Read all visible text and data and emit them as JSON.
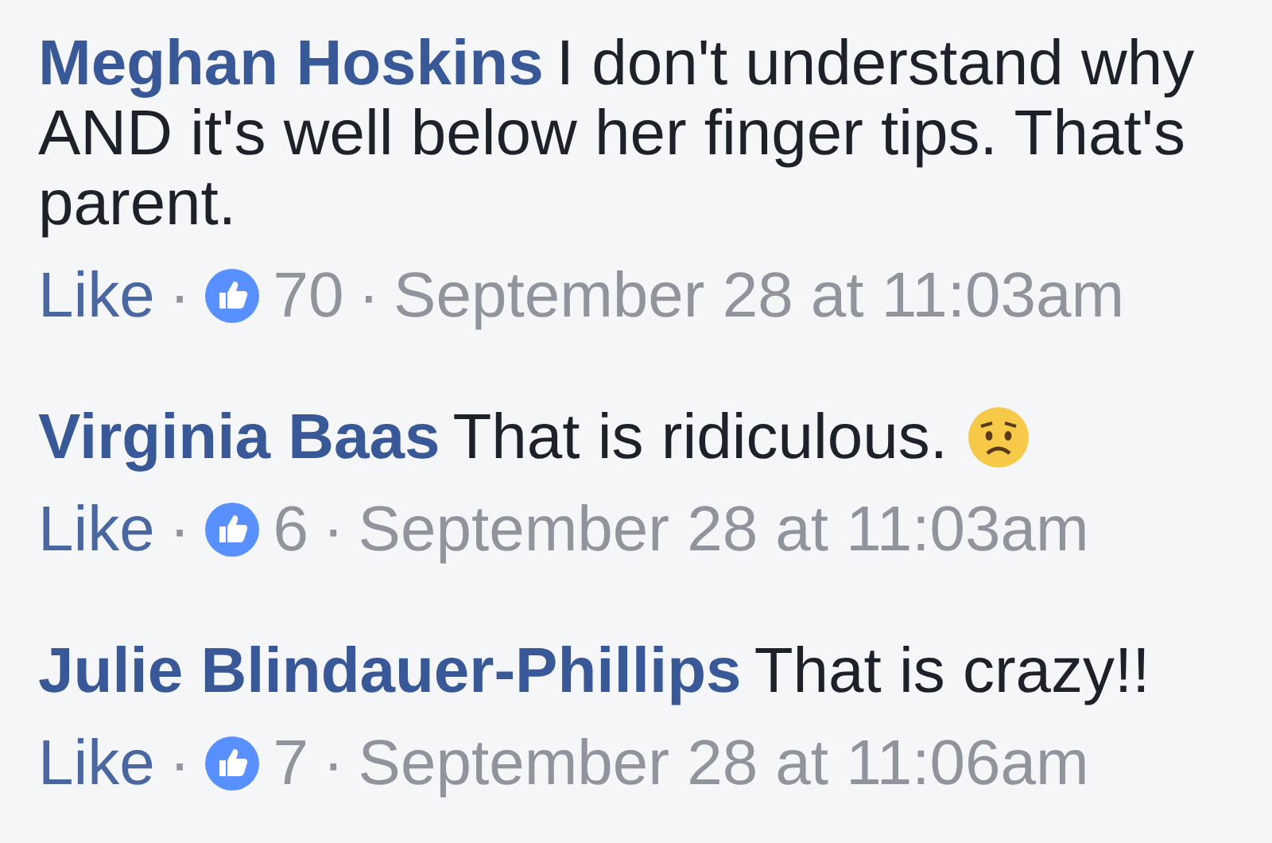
{
  "comments": [
    {
      "author": "Meghan Hoskins",
      "text_lines": [
        "I don't understand why",
        "AND it's well below her finger tips. That's",
        "parent."
      ],
      "emoji": false,
      "like_label": "Like",
      "separators": [
        "·",
        "·"
      ],
      "likes": "70",
      "time": "September 28 at 11:03am"
    },
    {
      "author": "Virginia Baas",
      "text_lines": [
        "That is ridiculous."
      ],
      "emoji": true,
      "like_label": "Like",
      "separators": [
        "·",
        "·"
      ],
      "likes": "6",
      "time": "September 28 at 11:03am"
    },
    {
      "author": "Julie Blindauer-Phillips",
      "text_lines": [
        "That is crazy!!"
      ],
      "emoji": false,
      "like_label": "Like",
      "separators": [
        "·",
        "·"
      ],
      "likes": "7",
      "time": "September 28 at 11:06am"
    }
  ]
}
